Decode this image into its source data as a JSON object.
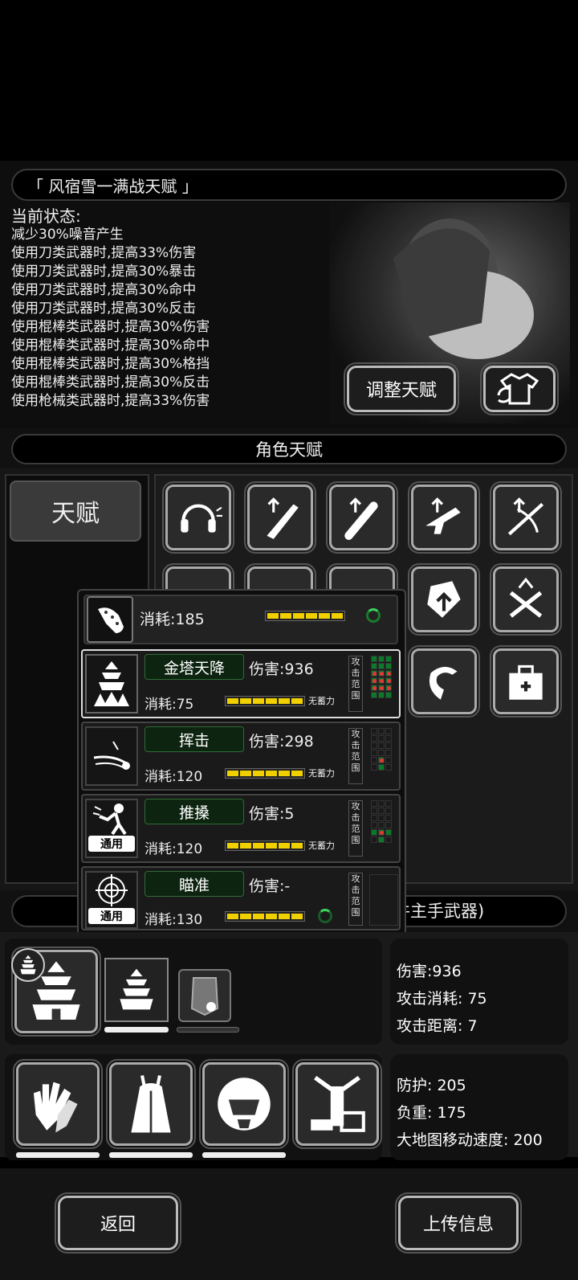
{
  "header": {
    "title": "「 风宿雪一满战天赋 」"
  },
  "status": {
    "heading": "当前状态:",
    "lines": [
      "减少30%噪音产生",
      "使用刀类武器时,提高33%伤害",
      "使用刀类武器时,提高30%暴击",
      "使用刀类武器时,提高30%命中",
      "使用刀类武器时,提高30%反击",
      "使用棍棒类武器时,提高30%伤害",
      "使用棍棒类武器时,提高30%命中",
      "使用棍棒类武器时,提高30%格挡",
      "使用棍棒类武器时,提高30%反击",
      "使用枪械类武器时,提高33%伤害"
    ],
    "adjust_button": "调整天赋"
  },
  "talent_section": {
    "title": "角色天赋",
    "tab": "天赋"
  },
  "skill_popup": {
    "top": {
      "cost": "消耗:185"
    },
    "skills": [
      {
        "name": "金塔天降",
        "damage": "伤害:936",
        "cost": "消耗:75",
        "charge": "无蓄力",
        "range_label": "攻击范围"
      },
      {
        "name": "挥击",
        "damage": "伤害:298",
        "cost": "消耗:120",
        "charge": "无蓄力",
        "range_label": "攻击范围"
      },
      {
        "name": "推搡",
        "damage": "伤害:5",
        "cost": "消耗:120",
        "charge": "无蓄力",
        "range_label": "攻击范围",
        "badge": "通用"
      },
      {
        "name": "瞄准",
        "damage": "伤害:-",
        "cost": "消耗:130",
        "range_label": "攻击范围",
        "badge": "通用"
      }
    ]
  },
  "weapon_section": {
    "title_partial": "件主手武器)"
  },
  "weapon_stats": {
    "damage": "伤害:936",
    "attack_cost": "攻击消耗: 75",
    "attack_range": "攻击距离: 7"
  },
  "armor_stats": {
    "defense": "防护: 205",
    "load": "负重: 175",
    "map_speed": "大地图移动速度: 200"
  },
  "footer": {
    "back": "返回",
    "upload": "上传信息"
  },
  "colors": {
    "accent_yellow": "#f0d000",
    "grid_green": "#0a7a2a"
  }
}
